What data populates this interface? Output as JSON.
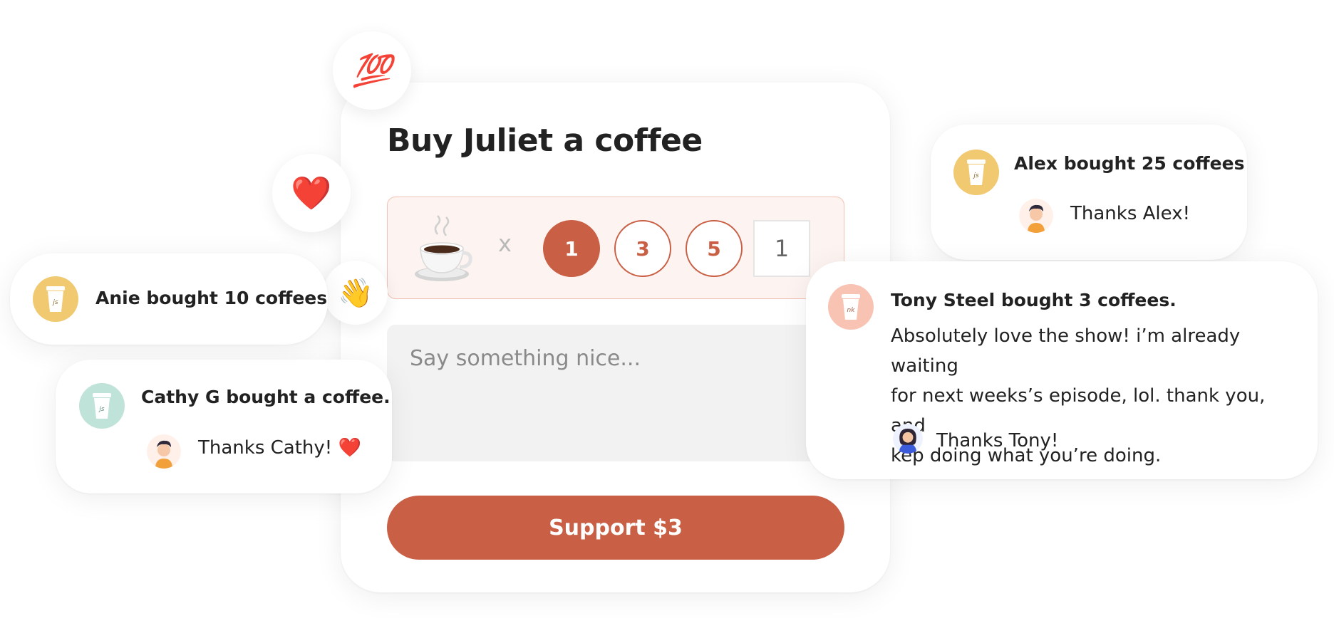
{
  "main": {
    "title": "Buy Juliet a coffee",
    "multiplier": "x",
    "quantity_options": [
      "1",
      "3",
      "5"
    ],
    "selected_quantity": "1",
    "custom_quantity": "1",
    "message_placeholder": "Say something nice...",
    "support_label": "Support $3"
  },
  "reactions": [
    "💯",
    "❤️",
    "👋"
  ],
  "notifications": {
    "anie": {
      "title": "Anie bought 10 coffees",
      "initials": "js"
    },
    "cathy": {
      "title": "Cathy G bought a coffee.",
      "reply": "Thanks Cathy! ❤️",
      "initials": "js"
    },
    "alex": {
      "title": "Alex bought 25 coffees",
      "reply": "Thanks Alex!",
      "initials": "js"
    },
    "tony": {
      "title": "Tony Steel bought 3 coffees.",
      "message_lines": [
        "Absolutely love the show! i’m already waiting",
        "for next weeks’s episode, lol. thank you, and",
        "kep doing what you’re doing."
      ],
      "reply": "Thanks Tony!",
      "initials": "nk"
    }
  },
  "colors": {
    "accent": "#c95f45",
    "accent_light": "#fdf3f0",
    "cup_yellow": "#f0c970",
    "cup_mint": "#bfe3d8",
    "cup_pink": "#f8c3b3"
  }
}
